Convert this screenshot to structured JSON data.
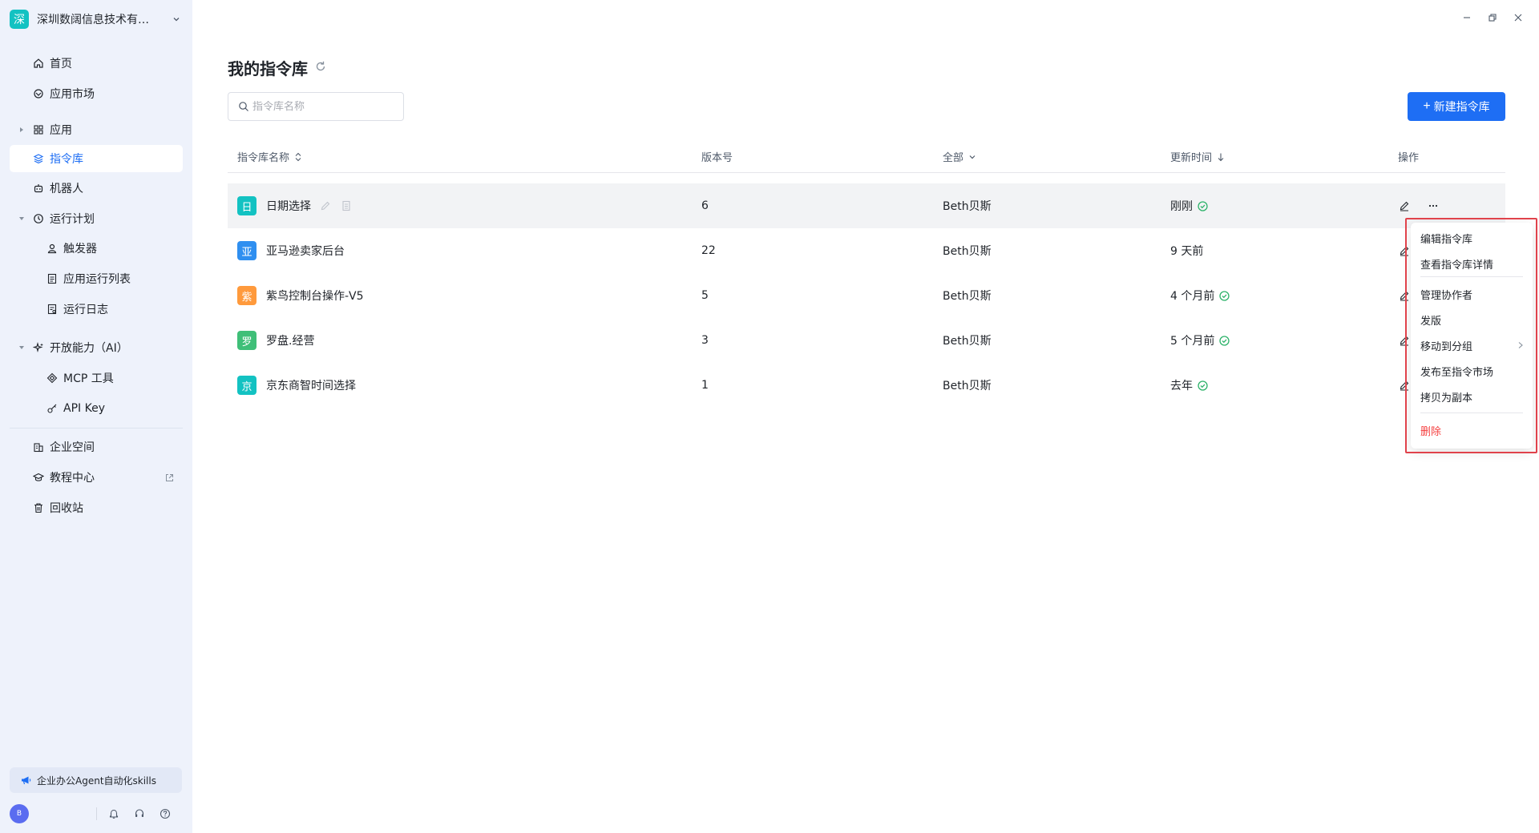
{
  "org": {
    "logo": "深",
    "name": "深圳数阔信息技术有限..."
  },
  "sidebar": {
    "items": [
      {
        "key": "home",
        "label": "首页",
        "icon": "home-icon"
      },
      {
        "key": "market",
        "label": "应用市场",
        "icon": "market-icon"
      },
      {
        "key": "apps",
        "label": "应用",
        "icon": "grid-icon"
      },
      {
        "key": "library",
        "label": "指令库",
        "icon": "layers-icon"
      },
      {
        "key": "robot",
        "label": "机器人",
        "icon": "robot-icon"
      },
      {
        "key": "schedule",
        "label": "运行计划",
        "icon": "clock-icon"
      },
      {
        "key": "trigger",
        "label": "触发器",
        "icon": "user-icon"
      },
      {
        "key": "runlist",
        "label": "应用运行列表",
        "icon": "doc-list-icon"
      },
      {
        "key": "runlog",
        "label": "运行日志",
        "icon": "doc-log-icon"
      },
      {
        "key": "ai",
        "label": "开放能力（AI）",
        "icon": "sparkle-icon"
      },
      {
        "key": "mcp",
        "label": "MCP 工具",
        "icon": "diamond-icon"
      },
      {
        "key": "apikey",
        "label": "API Key",
        "icon": "key-icon"
      },
      {
        "key": "enterprise",
        "label": "企业空间",
        "icon": "building-icon"
      },
      {
        "key": "tutorial",
        "label": "教程中心",
        "icon": "graduation-icon"
      },
      {
        "key": "trash",
        "label": "回收站",
        "icon": "trash-icon"
      }
    ],
    "promo": "企业办公Agent自动化skills",
    "avatar": "B"
  },
  "main": {
    "title": "我的指令库",
    "search_placeholder": "指令库名称",
    "new_button": "新建指令库",
    "columns": {
      "name": "指令库名称",
      "version": "版本号",
      "owner": "全部",
      "updated": "更新时间",
      "ops": "操作"
    },
    "rows": [
      {
        "icon_text": "日",
        "icon_color": "#13c2c2",
        "name": "日期选择",
        "version": "6",
        "owner": "Beth贝斯",
        "updated": "刚刚",
        "published": true
      },
      {
        "icon_text": "亚",
        "icon_color": "#2f8ff0",
        "name": "亚马逊卖家后台",
        "version": "22",
        "owner": "Beth贝斯",
        "updated": "9 天前",
        "published": false
      },
      {
        "icon_text": "紫",
        "icon_color": "#ff9a3c",
        "name": "紫鸟控制台操作-V5",
        "version": "5",
        "owner": "Beth贝斯",
        "updated": "4 个月前",
        "published": true
      },
      {
        "icon_text": "罗",
        "icon_color": "#3fbf78",
        "name": "罗盘.经营",
        "version": "3",
        "owner": "Beth贝斯",
        "updated": "5 个月前",
        "published": true
      },
      {
        "icon_text": "京",
        "icon_color": "#13c2c2",
        "name": "京东商智时间选择",
        "version": "1",
        "owner": "Beth贝斯",
        "updated": "去年",
        "published": true
      }
    ]
  },
  "context_menu": {
    "items": [
      {
        "label": "编辑指令库"
      },
      {
        "label": "查看指令库详情"
      },
      {
        "label": "管理协作者"
      },
      {
        "label": "发版"
      },
      {
        "label": "移动到分组"
      },
      {
        "label": "发布至指令市场"
      },
      {
        "label": "拷贝为副本"
      },
      {
        "label": "删除"
      }
    ]
  },
  "colors": {
    "accent": "#1e6ef4",
    "danger": "#f53f3f",
    "success": "#2fb36b",
    "sidebar_bg": "#eef2fb"
  }
}
